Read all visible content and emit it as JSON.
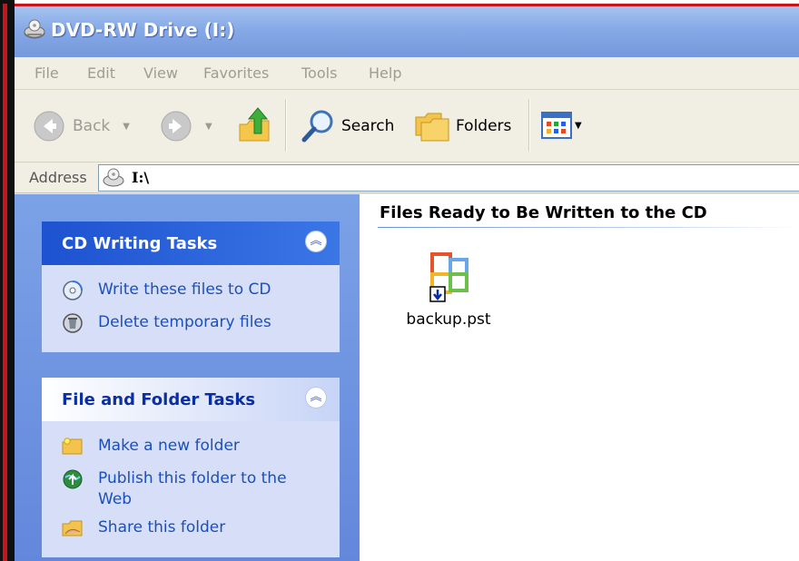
{
  "window": {
    "title": "DVD-RW Drive (I:)"
  },
  "menu": [
    "File",
    "Edit",
    "View",
    "Favorites",
    "Tools",
    "Help"
  ],
  "toolbar": {
    "back": "Back",
    "search": "Search",
    "folders": "Folders"
  },
  "address": {
    "label": "Address",
    "value": "I:\\"
  },
  "panels": {
    "cd": {
      "title": "CD Writing Tasks",
      "tasks": [
        "Write these files to CD",
        "Delete temporary files"
      ]
    },
    "folder": {
      "title": "File and Folder Tasks",
      "tasks": [
        "Make a new folder",
        "Publish this folder to the Web",
        "Share this folder"
      ]
    }
  },
  "content": {
    "group": "Files Ready to Be Written to the CD",
    "files": [
      {
        "name": "backup.pst",
        "icon": "outlook-data-file-icon"
      }
    ]
  },
  "colors": {
    "titlebar": "#7698dc",
    "taskpane": "#6f95e1",
    "panel": "#d6dff7",
    "link": "#1c4fbb",
    "panel_title": "#0b2fa0"
  }
}
